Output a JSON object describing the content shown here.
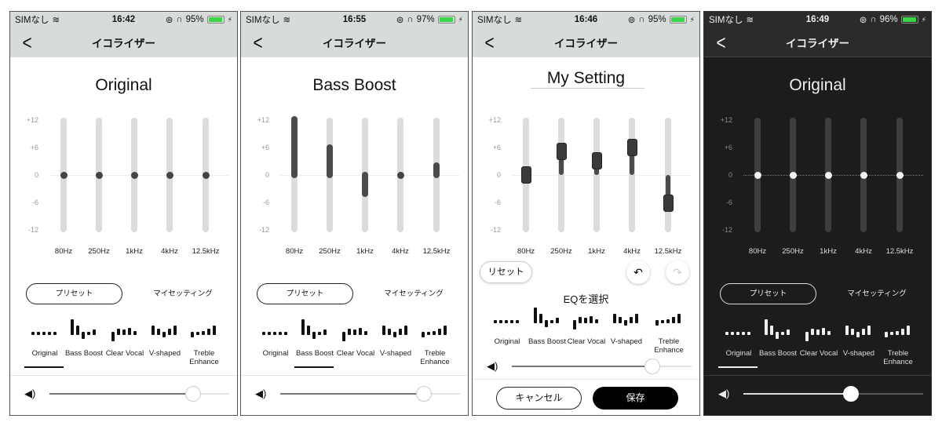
{
  "y_ticks": [
    "+12",
    "+6",
    "0",
    "-6",
    "-12"
  ],
  "bands": [
    "80Hz",
    "250Hz",
    "1kHz",
    "4kHz",
    "12.5kHz"
  ],
  "nav_title": "イコライザー",
  "tabs": {
    "preset": "プリセット",
    "my_setting": "マイセッティング"
  },
  "presets": [
    {
      "label": "Original",
      "bars": [
        0,
        0,
        0,
        0,
        0
      ]
    },
    {
      "label": "Bass Boost",
      "bars": [
        12,
        6,
        -4,
        0,
        2
      ]
    },
    {
      "label": "Clear Vocal",
      "bars": [
        -6,
        3,
        2,
        4,
        1
      ]
    },
    {
      "label": "V-shaped",
      "bars": [
        6,
        3,
        -2,
        3,
        6
      ]
    },
    {
      "label": "Treble Enhance",
      "bars": [
        -2,
        0,
        1,
        3,
        6
      ]
    }
  ],
  "screens": [
    {
      "status": {
        "carrier": "SIMなし",
        "time": "16:42",
        "battery": "95%",
        "battery_fraction": 0.95
      },
      "title": "Original",
      "mode": "slider",
      "eq_values_db": [
        0,
        0,
        0,
        0,
        0
      ],
      "selected_preset": 0,
      "volume_fraction": 0.8
    },
    {
      "status": {
        "carrier": "SIMなし",
        "time": "16:55",
        "battery": "97%",
        "battery_fraction": 0.97
      },
      "title": "Bass Boost",
      "mode": "slider",
      "eq_values_db": [
        12,
        6,
        -4,
        0,
        2
      ],
      "selected_preset": 1,
      "volume_fraction": 0.8
    },
    {
      "status": {
        "carrier": "SIMなし",
        "time": "16:46",
        "battery": "95%",
        "battery_fraction": 0.95
      },
      "title": "My Setting",
      "mode": "edit",
      "eq_values_db": [
        0,
        5,
        3,
        6,
        -6
      ],
      "volume_fraction": 0.78,
      "reset_label": "リセット",
      "eq_select_label": "EQを選択",
      "cancel_label": "キャンセル",
      "save_label": "保存"
    },
    {
      "status": {
        "carrier": "SIMなし",
        "time": "16:49",
        "battery": "96%",
        "battery_fraction": 0.96
      },
      "title": "Original",
      "mode": "slider",
      "theme": "dark",
      "eq_values_db": [
        0,
        0,
        0,
        0,
        0
      ],
      "selected_preset": 0,
      "volume_fraction": 0.6
    }
  ]
}
